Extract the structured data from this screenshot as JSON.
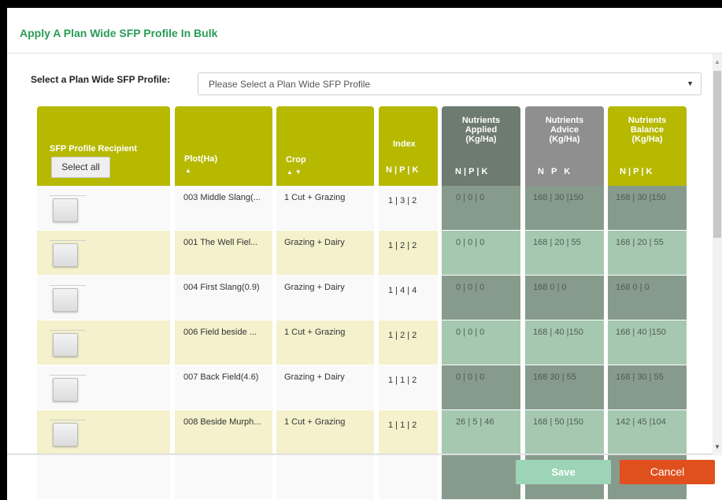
{
  "modal": {
    "title": "Apply A Plan Wide SFP Profile In Bulk",
    "select_label": "Select a Plan Wide SFP Profile:",
    "select_placeholder": "Please Select a Plan Wide SFP Profile"
  },
  "columns": {
    "recipient": {
      "label": "SFP Profile Recipient",
      "select_all": "Select all"
    },
    "plot": {
      "label": "Plot(Ha)"
    },
    "crop": {
      "label": "Crop"
    },
    "index": {
      "label": "Index",
      "npk": "N | P | K"
    },
    "applied": {
      "label": "Nutrients\nApplied\n(Kg/Ha)",
      "npk": "N | P | K"
    },
    "advice": {
      "label": "Nutrients\nAdvice\n(Kg/Ha)",
      "npk": "N P K"
    },
    "balance": {
      "label": "Nutrients\nBalance\n(Kg/Ha)",
      "npk": "N | P | K"
    }
  },
  "rows": [
    {
      "plot": "003 Middle Slang(...",
      "crop": "1 Cut + Grazing",
      "index": "1 | 3 | 2",
      "applied": "0 | 0 | 0",
      "advice": "168 | 30 |150",
      "balance": "168 | 30 |150"
    },
    {
      "plot": "001 The Well Fiel...",
      "crop": "Grazing + Dairy",
      "index": "1 | 2 | 2",
      "applied": "0 | 0 | 0",
      "advice": "168 | 20 | 55",
      "balance": "168 | 20 | 55"
    },
    {
      "plot": "004 First Slang(0.9)",
      "crop": "Grazing + Dairy",
      "index": "1 | 4 | 4",
      "applied": "0 | 0 | 0",
      "advice": "168 0 | 0",
      "balance": "168 0 | 0"
    },
    {
      "plot": "006 Field beside ...",
      "crop": "1 Cut + Grazing",
      "index": "1 | 2 | 2",
      "applied": "0 | 0 | 0",
      "advice": "168 | 40 |150",
      "balance": "168 | 40 |150"
    },
    {
      "plot": "007 Back Field(4.6)",
      "crop": "Grazing + Dairy",
      "index": "1 | 1 | 2",
      "applied": "0 | 0 | 0",
      "advice": "168 30 | 55",
      "balance": "168 | 30 | 55"
    },
    {
      "plot": "008 Beside Murph...",
      "crop": "1 Cut + Grazing",
      "index": "1 | 1 | 2",
      "applied": "26 | 5 | 46",
      "advice": "168 | 50 |150",
      "balance": "142 | 45 |104"
    }
  ],
  "buttons": {
    "save": "Save",
    "cancel": "Cancel"
  },
  "icons": {
    "sort_asc": "sort-up-icon",
    "sort_both": "sort-both-icon",
    "caret": "caret-down-icon"
  },
  "colors": {
    "title": "#2a9c56",
    "header_olive": "#b6b900",
    "applied_header": "#6e7b70",
    "advice_header": "#8f8f8f",
    "save": "#9dd4b8",
    "cancel": "#e0501e"
  }
}
